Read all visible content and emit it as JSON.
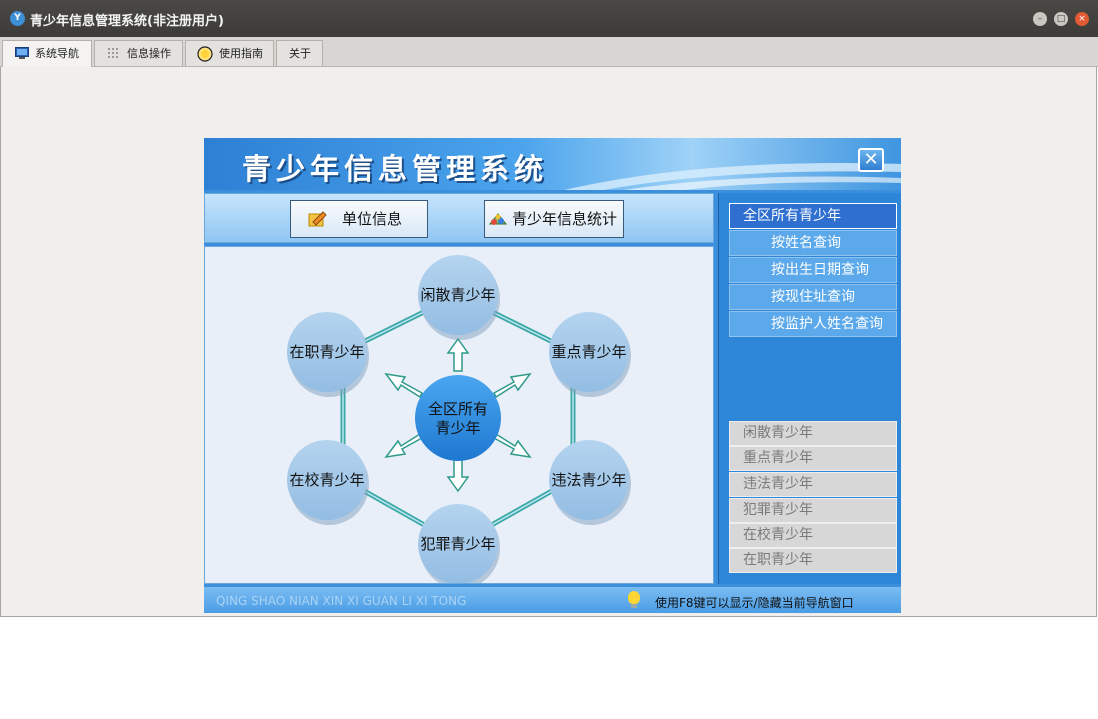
{
  "window": {
    "title": "青少年信息管理系统(非注册用户)",
    "app_icon": "app-logo-icon"
  },
  "tabs": [
    {
      "label": "系统导航",
      "icon": "monitor-icon",
      "active": true
    },
    {
      "label": "信息操作",
      "icon": "grid-icon",
      "active": false
    },
    {
      "label": "使用指南",
      "icon": "help-circle-icon",
      "active": false
    },
    {
      "label": "关于",
      "icon": "",
      "active": false
    }
  ],
  "banner": {
    "title": "青少年信息管理系统"
  },
  "toolbar": {
    "unit_info_label": "单位信息",
    "stats_label": "青少年信息统计"
  },
  "diagram": {
    "center": [
      "全区所有",
      "青少年"
    ],
    "nodes": [
      {
        "label": "闲散青少年"
      },
      {
        "label": "重点青少年"
      },
      {
        "label": "违法青少年"
      },
      {
        "label": "犯罪青少年"
      },
      {
        "label": "在校青少年"
      },
      {
        "label": "在职青少年"
      }
    ]
  },
  "query_menu": {
    "items": [
      {
        "label": "全区所有青少年",
        "selected": true
      },
      {
        "label": "按姓名查询",
        "selected": false
      },
      {
        "label": "按出生日期查询",
        "selected": false
      },
      {
        "label": "按现住址查询",
        "selected": false
      },
      {
        "label": "按监护人姓名查询",
        "selected": false
      }
    ]
  },
  "category_menu": {
    "items": [
      {
        "label": "闲散青少年"
      },
      {
        "label": "重点青少年"
      },
      {
        "label": "违法青少年"
      },
      {
        "label": "犯罪青少年"
      },
      {
        "label": "在校青少年"
      },
      {
        "label": "在职青少年"
      }
    ]
  },
  "status": {
    "left_text": "QING SHAO NIAN XIN XI GUAN LI XI TONG",
    "hint": "使用F8键可以显示/隐藏当前导航窗口"
  },
  "colors": {
    "panel_blue": "#3b8fdc",
    "node_fill": "#a8cbe9",
    "center_fill": "#2f8fe0",
    "connector": "#3ba9a4"
  }
}
